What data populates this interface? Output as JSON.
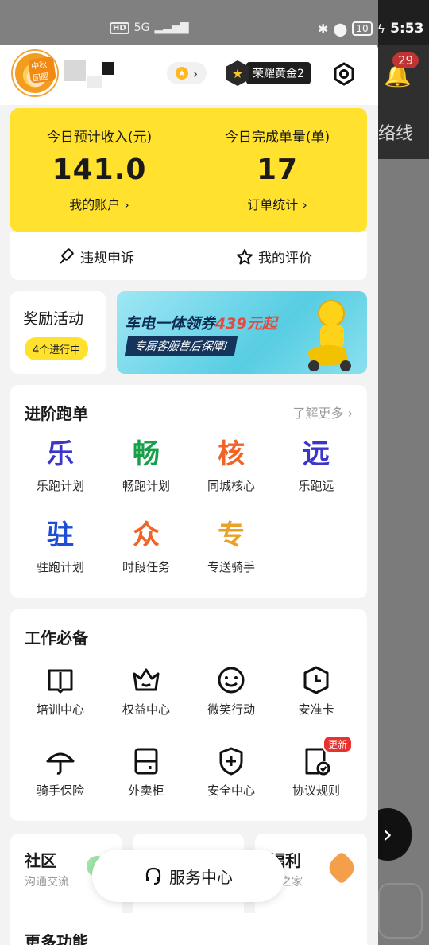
{
  "status_bar": {
    "network": "HD",
    "signal": "5G",
    "battery": "10",
    "time": "5:53"
  },
  "background": {
    "notification_count": "29",
    "partial_text": "络线"
  },
  "header": {
    "avatar_tag": "中秋团圆",
    "rank_label": "荣耀黄金2",
    "icons": [
      "coin-icon",
      "chevron-right-icon",
      "rank-star-icon",
      "settings-icon"
    ]
  },
  "earnings": {
    "income_label": "今日预计收入(元)",
    "income_value": "141.0",
    "income_link": "我的账户",
    "orders_label": "今日完成单量(单)",
    "orders_value": "17",
    "orders_link": "订单统计",
    "appeal_label": "违规申诉",
    "review_label": "我的评价",
    "accent_color": "#ffe12e"
  },
  "rewards": {
    "title": "奖励活动",
    "pill": "4个进行中",
    "banner_title_a": "车电一体领券",
    "banner_title_b": "439元起",
    "banner_sub": "专属客服售后保障!"
  },
  "advanced": {
    "title": "进阶跑单",
    "more": "了解更多",
    "items": [
      {
        "glyph": "乐",
        "label": "乐跑计划",
        "color": "#3b36c9"
      },
      {
        "glyph": "畅",
        "label": "畅跑计划",
        "color": "#17a04a"
      },
      {
        "glyph": "核",
        "label": "同城核心",
        "color": "#f06426"
      },
      {
        "glyph": "远",
        "label": "乐跑远",
        "color": "#3b36c9"
      },
      {
        "glyph": "驻",
        "label": "驻跑计划",
        "color": "#1d4fd6"
      },
      {
        "glyph": "众",
        "label": "时段任务",
        "color": "#f06426"
      },
      {
        "glyph": "专",
        "label": "专送骑手",
        "color": "#e9a126"
      }
    ]
  },
  "essentials": {
    "title": "工作必备",
    "badge": "更新",
    "items": [
      {
        "icon": "book-icon",
        "label": "培训中心"
      },
      {
        "icon": "crown-icon",
        "label": "权益中心"
      },
      {
        "icon": "smile-icon",
        "label": "微笑行动"
      },
      {
        "icon": "clock-shield-icon",
        "label": "安准卡"
      },
      {
        "icon": "umbrella-icon",
        "label": "骑手保险"
      },
      {
        "icon": "locker-icon",
        "label": "外卖柜"
      },
      {
        "icon": "shield-plus-icon",
        "label": "安全中心"
      },
      {
        "icon": "document-check-icon",
        "label": "协议规则"
      }
    ]
  },
  "bottom": {
    "community_title": "社区",
    "community_sub": "沟通交流",
    "welfare_title": "福利",
    "welfare_sub": "手之家",
    "service_label": "服务中心",
    "more_title": "更多功能"
  }
}
